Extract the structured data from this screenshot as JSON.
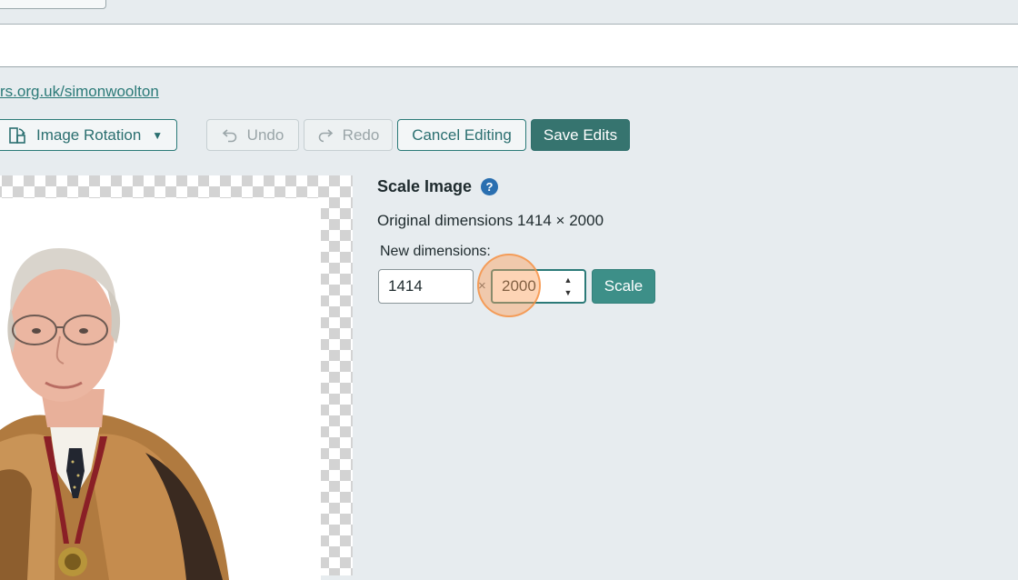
{
  "header": {
    "url_link": "rs.org.uk/simonwoolton"
  },
  "toolbar": {
    "rotation_label": "Image Rotation",
    "undo_label": "Undo",
    "redo_label": "Redo",
    "cancel_label": "Cancel Editing",
    "save_label": "Save Edits"
  },
  "scale_panel": {
    "title": "Scale Image",
    "help_glyph": "?",
    "original_dimensions": "Original dimensions 1414 × 2000",
    "new_dimensions_label": "New dimensions:",
    "width_value": "1414",
    "times_sign": "×",
    "height_value": "2000",
    "scale_button_label": "Scale"
  },
  "icons": {
    "rotation": "image-rotation-icon",
    "caret": "caret-down-icon",
    "undo": "undo-arrow-icon",
    "redo": "redo-arrow-icon",
    "help": "help-icon"
  },
  "colors": {
    "accent": "#2b7a78",
    "save_button": "#36746f",
    "scale_button": "#3d8f88",
    "help_icon": "#2a6fb0",
    "click_indicator": "#faa05a"
  }
}
